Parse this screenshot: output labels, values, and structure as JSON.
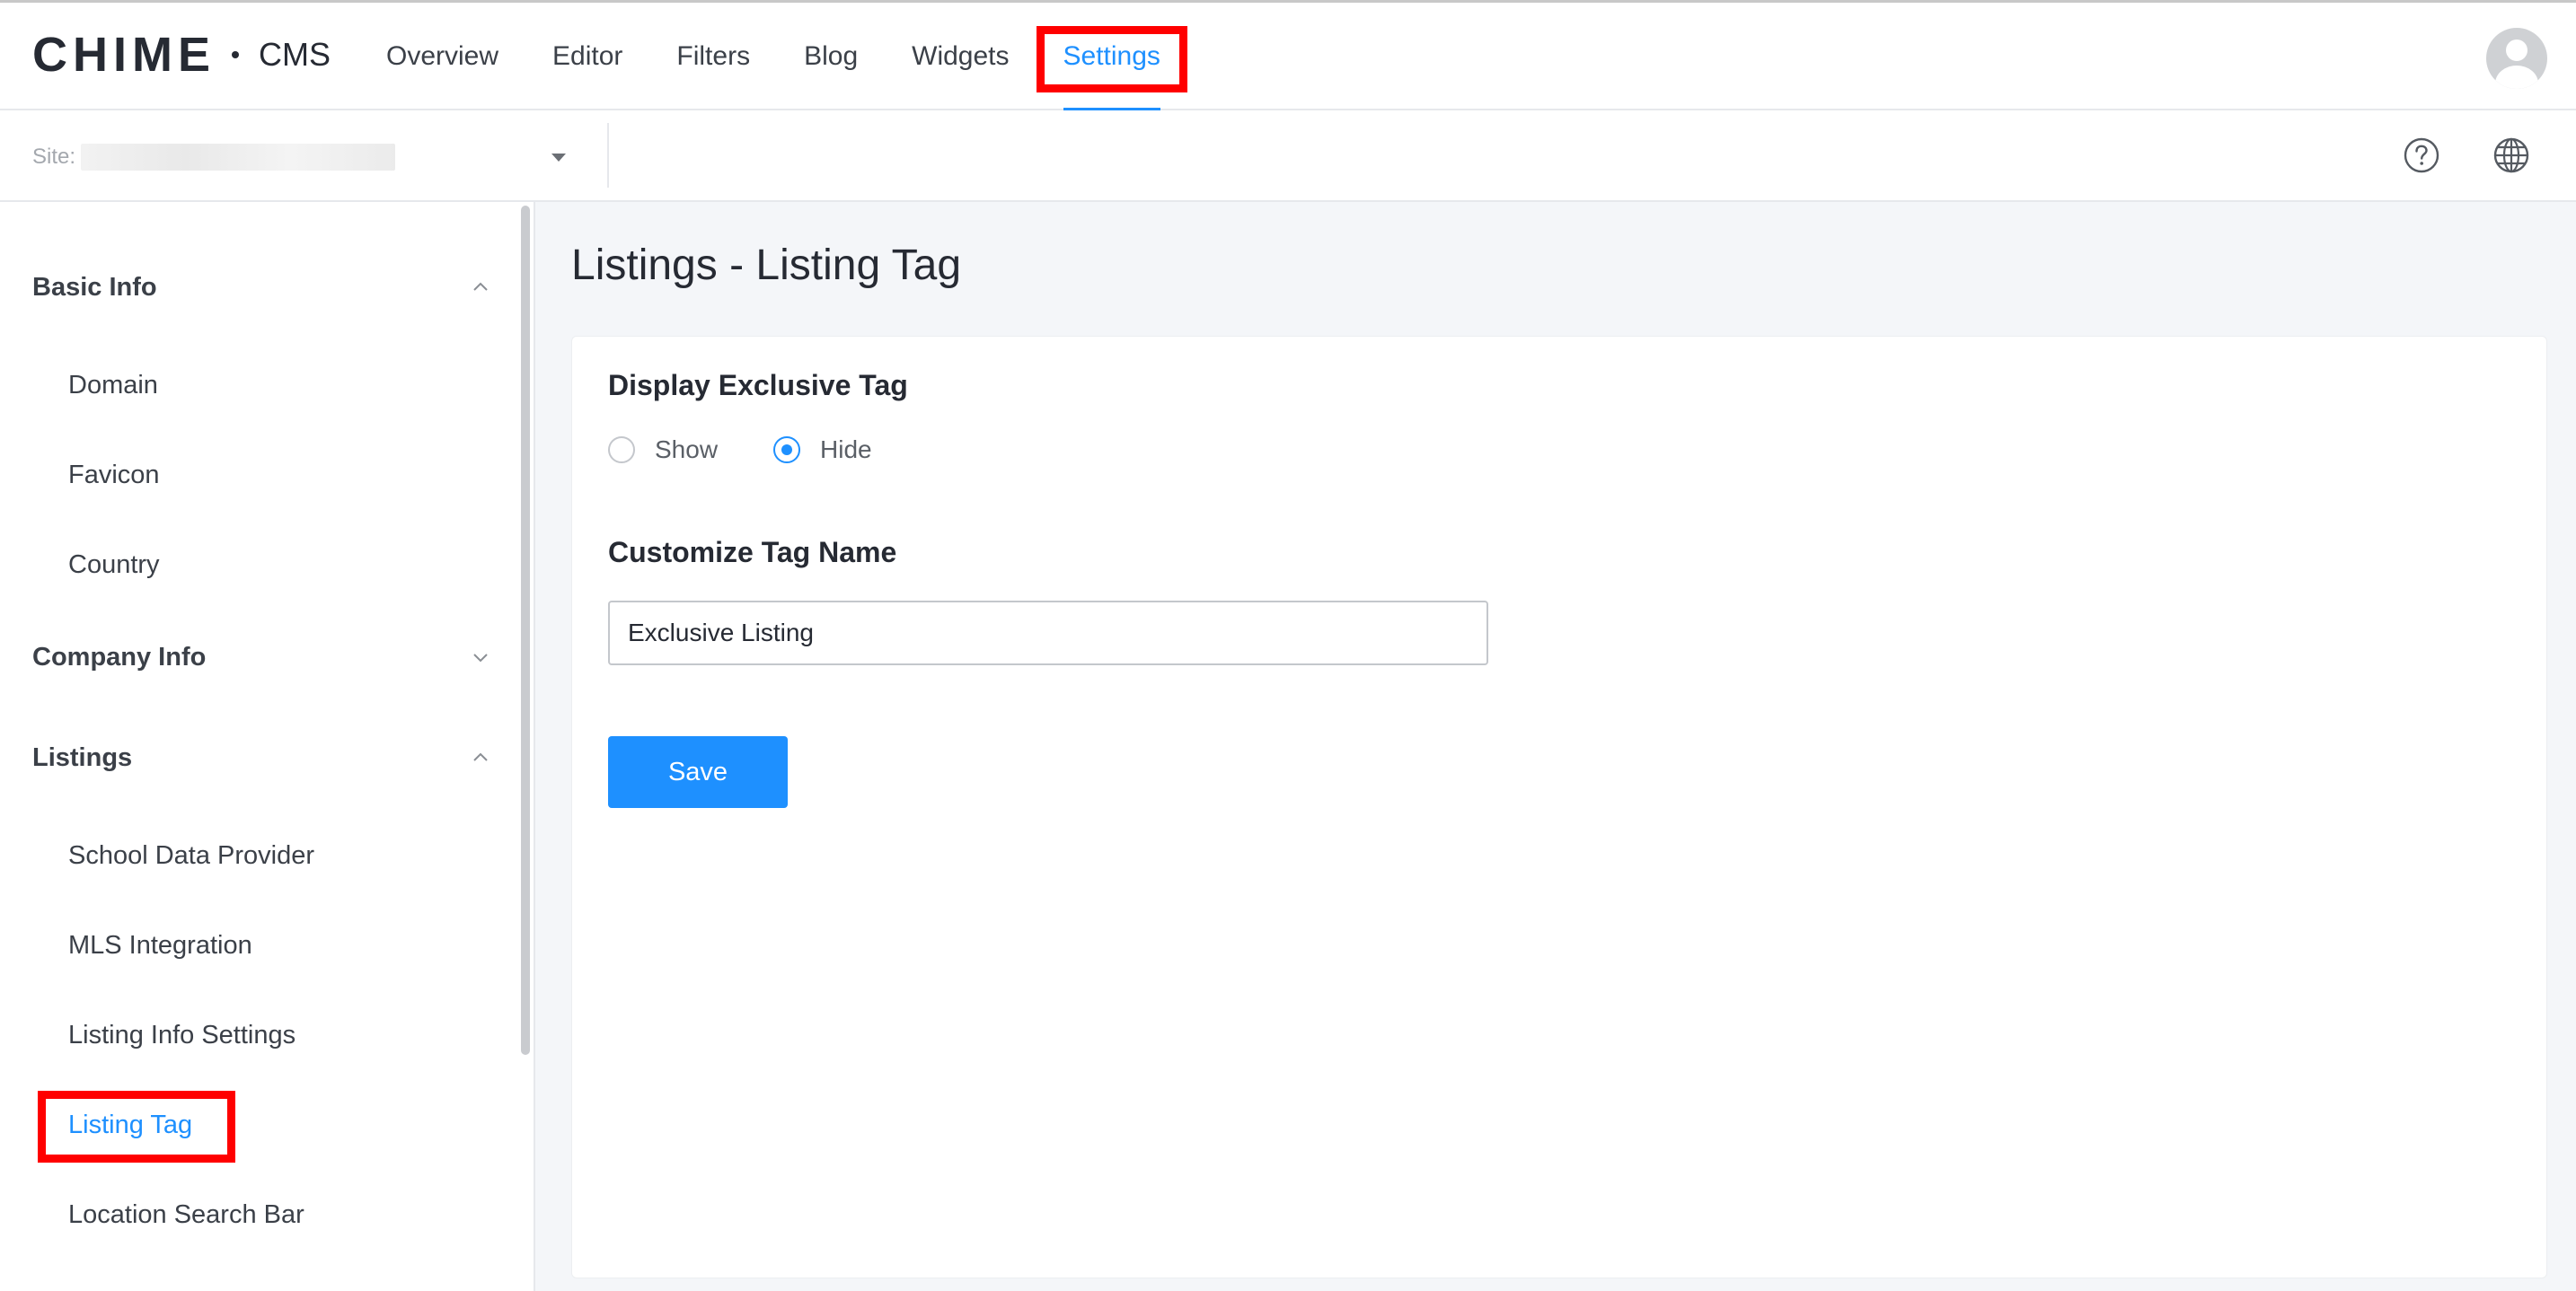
{
  "header": {
    "brand": "CHIME",
    "product": "CMS",
    "nav": [
      {
        "label": "Overview",
        "active": false
      },
      {
        "label": "Editor",
        "active": false
      },
      {
        "label": "Filters",
        "active": false
      },
      {
        "label": "Blog",
        "active": false
      },
      {
        "label": "Widgets",
        "active": false
      },
      {
        "label": "Settings",
        "active": true
      }
    ],
    "avatar_icon": "user-avatar-icon"
  },
  "subheader": {
    "site_label": "Site:",
    "help_icon": "help-circle-icon",
    "language_icon": "globe-icon"
  },
  "sidebar": {
    "groups": [
      {
        "title": "Basic Info",
        "expanded": true,
        "items": [
          "Domain",
          "Favicon",
          "Country"
        ]
      },
      {
        "title": "Company Info",
        "expanded": false,
        "items": []
      },
      {
        "title": "Listings",
        "expanded": true,
        "items": [
          "School Data Provider",
          "MLS Integration",
          "Listing Info Settings",
          "Listing Tag",
          "Location Search Bar"
        ]
      }
    ],
    "active_item": "Listing Tag"
  },
  "main": {
    "title": "Listings - Listing Tag",
    "display_section": {
      "title": "Display Exclusive Tag",
      "options": [
        "Show",
        "Hide"
      ],
      "selected": "Hide"
    },
    "name_section": {
      "title": "Customize Tag Name",
      "value": "Exclusive Listing"
    },
    "save_label": "Save"
  },
  "colors": {
    "accent": "#1e90ff",
    "highlight": "#ff0000",
    "text": "#262a33",
    "background": "#f4f6f9"
  }
}
